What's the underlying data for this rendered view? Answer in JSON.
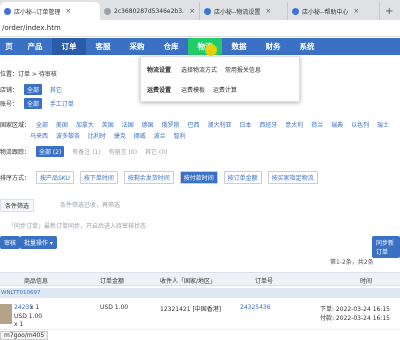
{
  "browser": {
    "tabs": [
      {
        "label": "店小秘--订单管理",
        "active": true
      },
      {
        "label": "2c3680287d5346e2b3…",
        "active": false
      },
      {
        "label": "店小秘--物流设置",
        "active": false
      },
      {
        "label": "店小秘--帮助中心",
        "active": false
      }
    ],
    "url": "/order/index.htm"
  },
  "nav": {
    "items": [
      "页",
      "产品",
      "订单",
      "客服",
      "采购",
      "仓库",
      "物流",
      "数据",
      "财务",
      "系统"
    ]
  },
  "dropdown": {
    "row1_head": "物流设置",
    "row1_links": [
      "选择物流方式",
      "常用报关信息"
    ],
    "row2_head": "运费设置",
    "row2_links": [
      "运费模板",
      "运费计算"
    ]
  },
  "breadcrumb": "位置：订单 > 待审核",
  "filters": {
    "store_label": "店铺：",
    "store_options": [
      "全部",
      "其它"
    ],
    "platform_label": "账号：",
    "platform_options": [
      "全部",
      "手工订单"
    ],
    "country_label": "国家区域：",
    "country_row1": [
      "全部",
      "美国",
      "加拿大",
      "英国",
      "法国",
      "德国",
      "俄罗斯",
      "巴西",
      "澳大利亚",
      "日本",
      "西班牙",
      "意大利",
      "荷兰",
      "瑞典",
      "以色列",
      "瑞士"
    ],
    "country_row2": [
      "马来西",
      "波多黎各",
      "比利时",
      "捷克",
      "挪威",
      "波兰",
      "智利"
    ],
    "track_label": "物流跟踪：",
    "track_options": [
      "全部 (2)",
      "有备注 (1)",
      "有留言 (0)",
      "其它 (0)"
    ],
    "sort_label": "排序方式：",
    "sort_options": [
      "按产品SKU",
      "按下单时间",
      "按剩余发货时间",
      "按付款时间",
      "按订单金额",
      "按买家指定物流"
    ],
    "filter_tab": "条件筛选",
    "tip1": "条件筛选已收，再筛选",
    "tip2": "「同步订单」最新订单同步，开启后进入待审核状态"
  },
  "toolbar": {
    "audit_btn": "审核",
    "batch_btn": "批量操作 ▾",
    "sync_btn": "同步新订单",
    "pager": "第1-2条，共2条"
  },
  "table": {
    "headers": [
      "商品信息",
      "订单金额",
      "收件人「国家/地区」",
      "订单号",
      "时间"
    ],
    "group_id": "WNLTT010697",
    "row": {
      "sku": "24235",
      "qty1": "x 1",
      "price": "USD 1.00",
      "qty2": "x 1",
      "amount": "USD 1.00",
      "recipient": "12321421 [中国香港]",
      "order_no": "24325436",
      "order_time": "下单: 2022-03-24 16:15",
      "pay_time": "付款: 2022-03-24 16:15"
    }
  },
  "status_url": "m7goo/m405"
}
